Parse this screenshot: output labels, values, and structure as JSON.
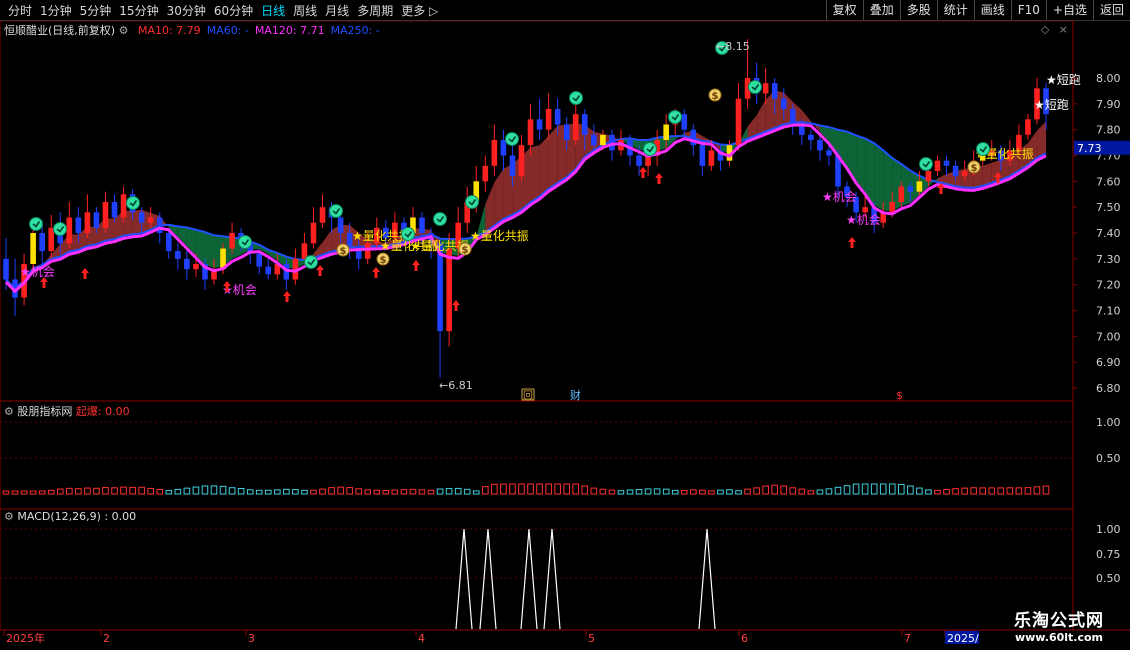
{
  "toolbar": {
    "periods": [
      "分时",
      "1分钟",
      "5分钟",
      "15分钟",
      "30分钟",
      "60分钟",
      "日线",
      "周线",
      "月线",
      "多周期",
      "更多 ▷"
    ],
    "active_index": 6,
    "right_buttons": [
      "复权",
      "叠加",
      "多股",
      "统计",
      "画线",
      "F10",
      "+自选",
      "返回"
    ]
  },
  "main_panel": {
    "title": "恒顺醋业(日线,前复权)",
    "ma_labels": [
      {
        "text": "MA10: 7.79",
        "color": "#ff3030"
      },
      {
        "text": "MA60: -",
        "color": "#2050ff"
      },
      {
        "text": "MA120: 7.71",
        "color": "#ff30ff"
      },
      {
        "text": "MA250: -",
        "color": "#2050ff"
      }
    ],
    "price_axis": [
      "8.00",
      "7.90",
      "7.80",
      "7.70",
      "7.60",
      "7.50",
      "7.40",
      "7.30",
      "7.20",
      "7.10",
      "7.00",
      "6.90",
      "6.80"
    ],
    "current_price": "7.73",
    "high_label": "8.15",
    "low_label": "6.81",
    "signal_labels": [
      "机会",
      "机会",
      "量化共振",
      "量化共振",
      "量化共振",
      "量化共振",
      "机会",
      "机会",
      "量化共振",
      "短跑",
      "短跑"
    ],
    "markers": [
      "回",
      "财",
      "$"
    ]
  },
  "indicator_panel": {
    "name": "股朋指标网",
    "label": "起爆: 0.00",
    "axis": [
      "1.00",
      "0.50"
    ]
  },
  "macd_panel": {
    "label": "MACD(12,26,9) : 0.00",
    "axis": [
      "1.00",
      "0.75",
      "0.50"
    ]
  },
  "time_axis": [
    "2025年",
    "2",
    "3",
    "4",
    "5",
    "6",
    "7",
    "2025/"
  ],
  "watermark": {
    "title": "乐淘公式网",
    "url": "www.60lt.com"
  },
  "chart_data": {
    "type": "candlestick",
    "title": "恒顺醋业(日线,前复权)",
    "y_range": [
      6.8,
      8.0
    ],
    "high": 8.15,
    "low": 6.81,
    "last": 7.73,
    "ma": {
      "MA10": 7.79,
      "MA120": 7.71
    },
    "bars": [
      [
        7.3,
        7.22,
        7.38,
        7.18
      ],
      [
        7.22,
        7.15,
        7.3,
        7.08
      ],
      [
        7.15,
        7.28,
        7.32,
        7.12
      ],
      [
        7.28,
        7.4,
        7.44,
        7.25
      ],
      [
        7.4,
        7.33,
        7.45,
        7.28
      ],
      [
        7.33,
        7.42,
        7.47,
        7.3
      ],
      [
        7.42,
        7.36,
        7.48,
        7.32
      ],
      [
        7.36,
        7.46,
        7.52,
        7.34
      ],
      [
        7.46,
        7.4,
        7.5,
        7.36
      ],
      [
        7.4,
        7.48,
        7.55,
        7.38
      ],
      [
        7.48,
        7.42,
        7.5,
        7.4
      ],
      [
        7.42,
        7.52,
        7.56,
        7.4
      ],
      [
        7.52,
        7.46,
        7.55,
        7.44
      ],
      [
        7.46,
        7.55,
        7.58,
        7.44
      ],
      [
        7.55,
        7.48,
        7.57,
        7.45
      ],
      [
        7.48,
        7.44,
        7.5,
        7.4
      ],
      [
        7.44,
        7.46,
        7.5,
        7.42
      ],
      [
        7.46,
        7.4,
        7.48,
        7.36
      ],
      [
        7.4,
        7.33,
        7.42,
        7.3
      ],
      [
        7.33,
        7.3,
        7.36,
        7.26
      ],
      [
        7.3,
        7.26,
        7.34,
        7.22
      ],
      [
        7.26,
        7.28,
        7.32,
        7.23
      ],
      [
        7.28,
        7.22,
        7.3,
        7.18
      ],
      [
        7.22,
        7.26,
        7.3,
        7.2
      ],
      [
        7.26,
        7.34,
        7.36,
        7.24
      ],
      [
        7.34,
        7.4,
        7.44,
        7.32
      ],
      [
        7.4,
        7.36,
        7.42,
        7.33
      ],
      [
        7.36,
        7.32,
        7.38,
        7.28
      ],
      [
        7.32,
        7.27,
        7.34,
        7.24
      ],
      [
        7.27,
        7.24,
        7.3,
        7.22
      ],
      [
        7.24,
        7.28,
        7.32,
        7.22
      ],
      [
        7.28,
        7.22,
        7.3,
        7.18
      ],
      [
        7.22,
        7.3,
        7.34,
        7.2
      ],
      [
        7.3,
        7.36,
        7.4,
        7.28
      ],
      [
        7.36,
        7.44,
        7.5,
        7.34
      ],
      [
        7.44,
        7.5,
        7.55,
        7.42
      ],
      [
        7.5,
        7.46,
        7.52,
        7.4
      ],
      [
        7.46,
        7.4,
        7.48,
        7.36
      ],
      [
        7.4,
        7.35,
        7.44,
        7.3
      ],
      [
        7.35,
        7.3,
        7.38,
        7.26
      ],
      [
        7.3,
        7.36,
        7.4,
        7.28
      ],
      [
        7.36,
        7.42,
        7.46,
        7.34
      ],
      [
        7.42,
        7.38,
        7.45,
        7.35
      ],
      [
        7.38,
        7.44,
        7.48,
        7.36
      ],
      [
        7.44,
        7.4,
        7.46,
        7.37
      ],
      [
        7.4,
        7.46,
        7.5,
        7.38
      ],
      [
        7.46,
        7.4,
        7.48,
        7.36
      ],
      [
        7.4,
        7.36,
        7.42,
        7.3
      ],
      [
        7.36,
        7.02,
        7.38,
        6.84
      ],
      [
        7.02,
        7.34,
        7.4,
        6.96
      ],
      [
        7.34,
        7.44,
        7.5,
        7.3
      ],
      [
        7.44,
        7.52,
        7.58,
        7.4
      ],
      [
        7.52,
        7.6,
        7.66,
        7.48
      ],
      [
        7.6,
        7.66,
        7.7,
        7.56
      ],
      [
        7.66,
        7.76,
        7.82,
        7.62
      ],
      [
        7.76,
        7.7,
        7.8,
        7.64
      ],
      [
        7.7,
        7.62,
        7.74,
        7.58
      ],
      [
        7.62,
        7.74,
        7.78,
        7.6
      ],
      [
        7.74,
        7.84,
        7.9,
        7.7
      ],
      [
        7.84,
        7.8,
        7.92,
        7.76
      ],
      [
        7.8,
        7.88,
        7.94,
        7.76
      ],
      [
        7.88,
        7.82,
        7.92,
        7.78
      ],
      [
        7.82,
        7.76,
        7.85,
        7.72
      ],
      [
        7.76,
        7.86,
        7.92,
        7.74
      ],
      [
        7.86,
        7.78,
        7.88,
        7.72
      ],
      [
        7.78,
        7.74,
        7.82,
        7.7
      ],
      [
        7.74,
        7.78,
        7.8,
        7.72
      ],
      [
        7.78,
        7.72,
        7.8,
        7.68
      ],
      [
        7.72,
        7.76,
        7.8,
        7.7
      ],
      [
        7.76,
        7.7,
        7.78,
        7.66
      ],
      [
        7.7,
        7.66,
        7.74,
        7.62
      ],
      [
        7.66,
        7.7,
        7.74,
        7.62
      ],
      [
        7.7,
        7.76,
        7.8,
        7.66
      ],
      [
        7.76,
        7.82,
        7.86,
        7.72
      ],
      [
        7.82,
        7.86,
        7.88,
        7.78
      ],
      [
        7.86,
        7.8,
        7.88,
        7.76
      ],
      [
        7.8,
        7.74,
        7.82,
        7.7
      ],
      [
        7.74,
        7.66,
        7.76,
        7.62
      ],
      [
        7.66,
        7.72,
        7.76,
        7.64
      ],
      [
        7.72,
        7.68,
        7.74,
        7.64
      ],
      [
        7.68,
        7.74,
        7.76,
        7.66
      ],
      [
        7.74,
        7.92,
        7.98,
        7.72
      ],
      [
        7.92,
        8.0,
        8.15,
        7.88
      ],
      [
        8.0,
        7.94,
        8.06,
        7.9
      ],
      [
        7.94,
        7.98,
        8.04,
        7.9
      ],
      [
        7.98,
        7.92,
        8.0,
        7.86
      ],
      [
        7.92,
        7.88,
        7.96,
        7.84
      ],
      [
        7.88,
        7.82,
        7.9,
        7.78
      ],
      [
        7.82,
        7.78,
        7.84,
        7.74
      ],
      [
        7.78,
        7.76,
        7.8,
        7.72
      ],
      [
        7.76,
        7.72,
        7.78,
        7.68
      ],
      [
        7.72,
        7.7,
        7.74,
        7.66
      ],
      [
        7.7,
        7.58,
        7.72,
        7.54
      ],
      [
        7.58,
        7.54,
        7.6,
        7.5
      ],
      [
        7.54,
        7.48,
        7.56,
        7.44
      ],
      [
        7.48,
        7.5,
        7.54,
        7.46
      ],
      [
        7.5,
        7.44,
        7.52,
        7.4
      ],
      [
        7.44,
        7.48,
        7.52,
        7.42
      ],
      [
        7.48,
        7.52,
        7.56,
        7.46
      ],
      [
        7.52,
        7.58,
        7.6,
        7.5
      ],
      [
        7.58,
        7.56,
        7.6,
        7.52
      ],
      [
        7.56,
        7.6,
        7.64,
        7.54
      ],
      [
        7.6,
        7.64,
        7.68,
        7.58
      ],
      [
        7.64,
        7.68,
        7.7,
        7.62
      ],
      [
        7.68,
        7.66,
        7.7,
        7.62
      ],
      [
        7.66,
        7.62,
        7.68,
        7.6
      ],
      [
        7.62,
        7.64,
        7.68,
        7.6
      ],
      [
        7.64,
        7.68,
        7.72,
        7.62
      ],
      [
        7.68,
        7.7,
        7.74,
        7.66
      ],
      [
        7.7,
        7.72,
        7.76,
        7.68
      ],
      [
        7.72,
        7.68,
        7.74,
        7.64
      ],
      [
        7.68,
        7.72,
        7.76,
        7.66
      ],
      [
        7.72,
        7.78,
        7.82,
        7.7
      ],
      [
        7.78,
        7.84,
        7.86,
        7.76
      ],
      [
        7.84,
        7.96,
        8.0,
        7.82
      ],
      [
        7.96,
        7.86,
        7.98,
        7.8
      ]
    ]
  }
}
